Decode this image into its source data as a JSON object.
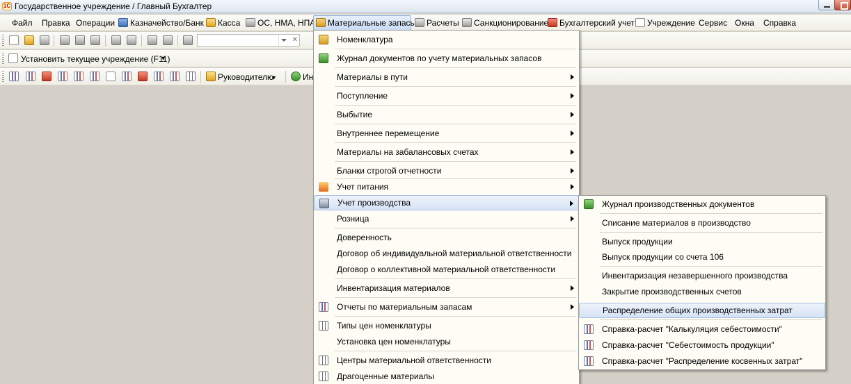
{
  "window": {
    "title": "Государственное учреждение / Главный Бухгалтер",
    "logo_text": "1С"
  },
  "menubar": {
    "items": [
      {
        "label": "Файл"
      },
      {
        "label": "Правка"
      },
      {
        "label": "Операции"
      },
      {
        "label": "Казначейство/Банк",
        "icon": "bank-icon"
      },
      {
        "label": "Касса",
        "icon": "coins-icon"
      },
      {
        "label": "ОС, НМА, НПА",
        "icon": "truck-icon"
      },
      {
        "label": "Материальные запасы",
        "icon": "boxes-icon"
      },
      {
        "label": "Расчеты",
        "icon": "calc-icon"
      },
      {
        "label": "Санкционирование",
        "icon": "sigma-icon"
      },
      {
        "label": "Бухгалтерский учет",
        "icon": "ledger-icon"
      },
      {
        "label": "Учреждение",
        "icon": "building-icon"
      },
      {
        "label": "Сервис"
      },
      {
        "label": "Окна"
      },
      {
        "label": "Справка"
      }
    ]
  },
  "toolbar2": {
    "set_org_label": "Установить текущее учреждение (F11)"
  },
  "toolbar3": {
    "manager_label": "Руководителю",
    "trailing_label": "Ин"
  },
  "dropdown": {
    "items": [
      {
        "label": "Номенклатура",
        "icon": "catalog-icon"
      },
      {
        "label": "Журнал документов по учету материальных запасов",
        "icon": "journal-icon"
      },
      {
        "label": "Материалы в пути",
        "submenu": true
      },
      {
        "label": "Поступление",
        "submenu": true
      },
      {
        "label": "Выбытие",
        "submenu": true
      },
      {
        "label": "Внутреннее перемещение",
        "submenu": true
      },
      {
        "label": "Материалы на забалансовых счетах",
        "submenu": true
      },
      {
        "label": "Бланки строгой отчетности",
        "submenu": true
      },
      {
        "label": "Учет питания",
        "icon": "food-icon",
        "submenu": true
      },
      {
        "label": "Учет производства",
        "icon": "production-icon",
        "submenu": true,
        "highlighted": true
      },
      {
        "label": "Розница",
        "submenu": true
      },
      {
        "label": "Доверенность"
      },
      {
        "label": "Договор об индивидуальной материальной ответственности"
      },
      {
        "label": "Договор о коллективной материальной ответственности"
      },
      {
        "label": "Инвентаризация материалов",
        "submenu": true
      },
      {
        "label": "Отчеты по материальным запасам",
        "icon": "report-icon",
        "submenu": true
      },
      {
        "label": "Типы цен номенклатуры",
        "icon": "table-icon"
      },
      {
        "label": "Установка цен номенклатуры"
      },
      {
        "label": "Центры материальной ответственности",
        "icon": "table-icon"
      },
      {
        "label": "Драгоценные материалы",
        "icon": "table-icon"
      }
    ]
  },
  "submenu": {
    "items": [
      {
        "label": "Журнал производственных документов",
        "icon": "journal-icon"
      },
      {
        "label": "Списание материалов в производство"
      },
      {
        "label": "Выпуск продукции"
      },
      {
        "label": "Выпуск продукции со счета 106"
      },
      {
        "label": "Инвентаризация незавершенного производства"
      },
      {
        "label": "Закрытие производственных счетов"
      },
      {
        "label": "Распределение общих производственных затрат",
        "highlighted": true
      },
      {
        "label": "Справка-расчет \"Калькуляция себестоимости\"",
        "icon": "report-icon"
      },
      {
        "label": "Справка-расчет \"Себестоимость продукции\"",
        "icon": "report-icon"
      },
      {
        "label": "Справка-расчет \"Распределение косвенных затрат\"",
        "icon": "report-icon"
      }
    ]
  },
  "colors": {
    "workspace": "#d4d0c8",
    "menu_bg": "#fdfcf5",
    "highlight": "#d6e3f5"
  }
}
